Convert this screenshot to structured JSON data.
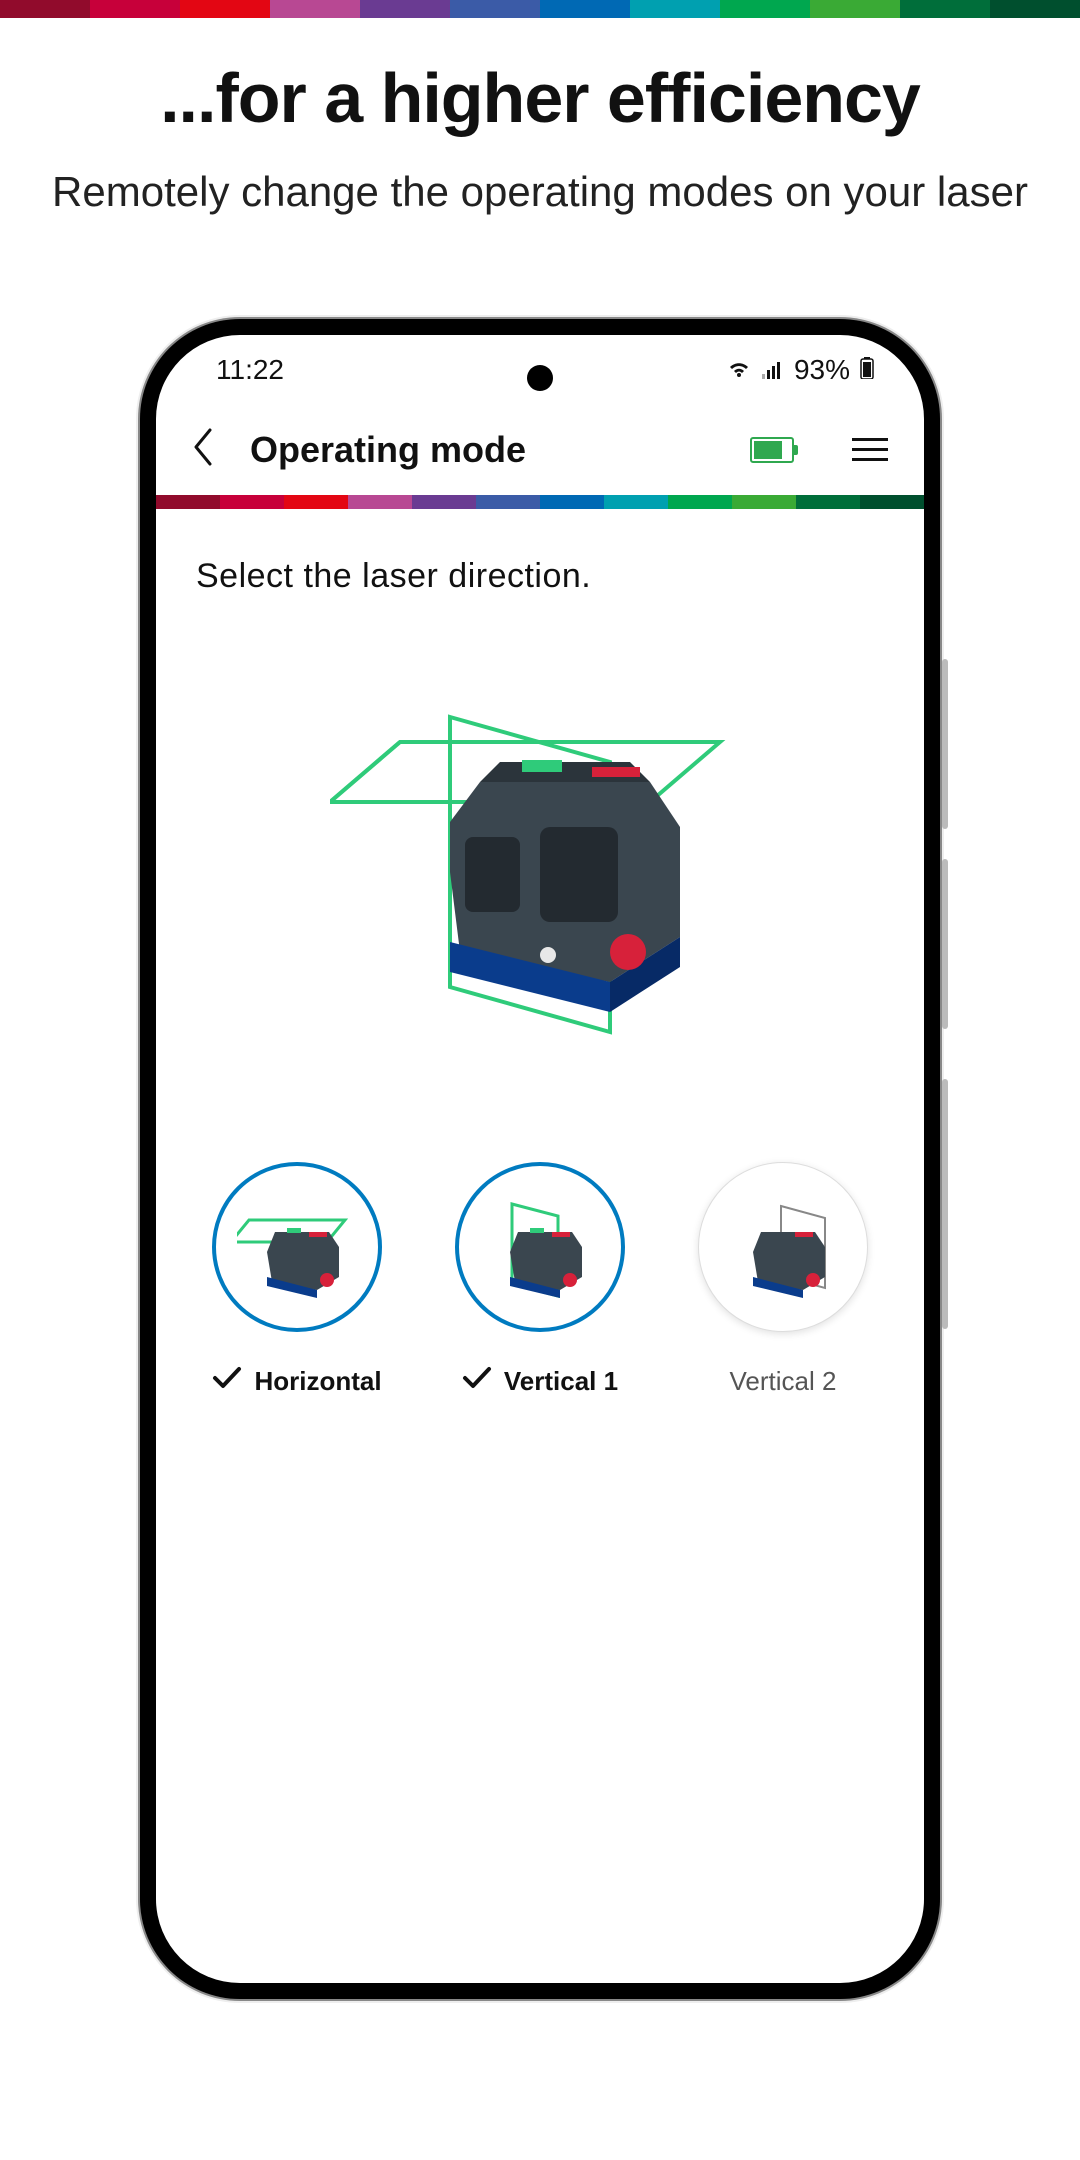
{
  "brand_colors": [
    "#910b2c",
    "#c7003a",
    "#e30613",
    "#b84893",
    "#6a3b92",
    "#3b5ba7",
    "#0069b4",
    "#00a0b0",
    "#00a74f",
    "#3aaa35",
    "#006e3a",
    "#004f2e"
  ],
  "promo": {
    "title": "...for a higher efficiency",
    "subtitle": "Remotely change the operating modes on your laser"
  },
  "status": {
    "time": "11:22",
    "battery_pct": "93%"
  },
  "appbar": {
    "title": "Operating mode"
  },
  "screen": {
    "instruction": "Select the laser direction."
  },
  "options": [
    {
      "label": "Horizontal",
      "selected": true
    },
    {
      "label": "Vertical 1",
      "selected": true
    },
    {
      "label": "Vertical 2",
      "selected": false
    }
  ]
}
